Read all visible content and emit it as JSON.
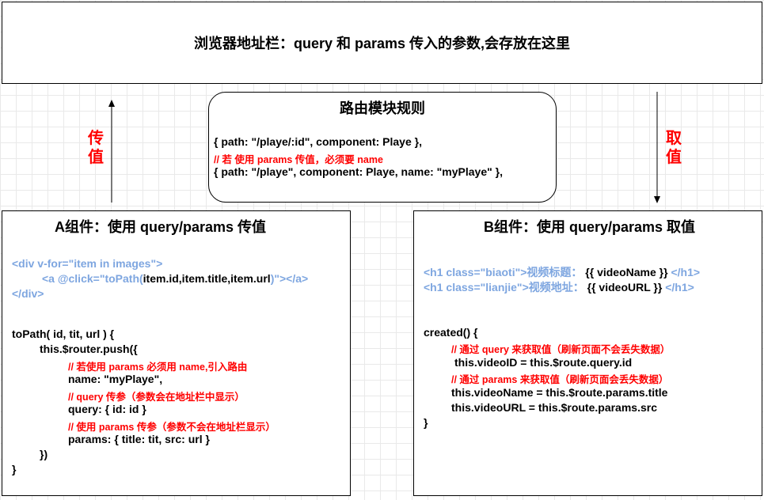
{
  "address_bar": {
    "text": "浏览器地址栏：query 和 params 传入的参数,会存放在这里"
  },
  "routing": {
    "title": "路由模块规则",
    "line1": "{ path: \"/playe/:id\", component: Playe },",
    "comment": "// 若 使用 params 传值，必须要 name",
    "line2": "{ path: \"/playe\", component: Playe, name: \"myPlaye\" },"
  },
  "left_label": {
    "c1": "传",
    "c2": "值"
  },
  "right_label": {
    "c1": "取",
    "c2": "值"
  },
  "comp_a": {
    "title": "A组件：使用 query/params 传值",
    "tpl1": "<div v-for=\"item in images\">",
    "tpl2a": "<a @click=\"toPath(",
    "tpl2b": "item.id,item.title,item.url",
    "tpl2c": ")\"></a>",
    "tpl3": "</div>",
    "code1": "toPath( id, tit, url ) {",
    "code2": "this.$router.push({",
    "c_name": "// 若使用 params 必须用 name,引入路由",
    "code3": "name: \"myPlaye\",",
    "c_query": "// query 传参（参数会在地址栏中显示）",
    "code4": "query: { id: id }",
    "c_params": "// 使用 params 传参（参数不会在地址栏显示）",
    "code5": "params: { title: tit, src: url }",
    "code6": "})",
    "code7": "}"
  },
  "comp_b": {
    "title": "B组件：使用 query/params 取值",
    "h1a_open": "<h1 class=\"biaoti\">视频标题：",
    "h1a_mid": "{{ videoName }}",
    "h1a_close": "</h1>",
    "h1b_open": "<h1 class=\"lianjie\">视频地址：",
    "h1b_mid": "{{ videoURL }}",
    "h1b_close": "</h1>",
    "code1": "created() {",
    "c_query": "// 通过 query 来获取值（刷新页面不会丢失数据）",
    "code2": "this.videoID = this.$route.query.id",
    "c_params": "// 通过 params 来获取值（刷新页面会丢失数据）",
    "code3": "this.videoName = this.$route.params.title",
    "code4": "this.videoURL = this.$route.params.src",
    "code5": "}"
  }
}
